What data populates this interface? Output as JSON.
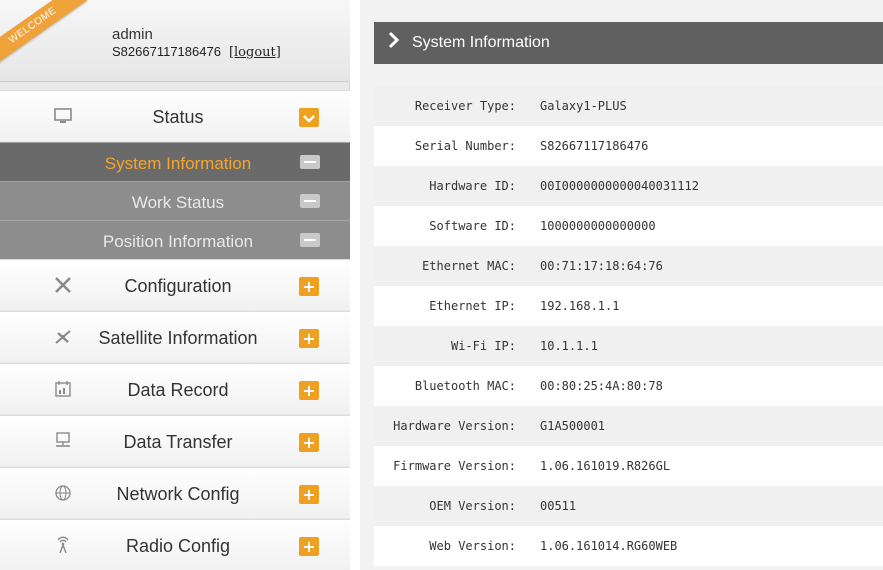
{
  "user": {
    "welcome": "WELCOME",
    "name": "admin",
    "serial": "S82667117186476",
    "logout_label": "[logout]"
  },
  "menu": {
    "status": {
      "label": "Status",
      "icon": "monitor-icon",
      "expander": "collapse"
    },
    "sub_items": [
      {
        "label": "System Information",
        "active": true
      },
      {
        "label": "Work Status",
        "active": false
      },
      {
        "label": "Position Information",
        "active": false
      }
    ],
    "items": [
      {
        "label": "Configuration",
        "icon": "tools-icon",
        "expander": "expand"
      },
      {
        "label": "Satellite Information",
        "icon": "satellite-icon",
        "expander": "expand"
      },
      {
        "label": "Data Record",
        "icon": "calendar-icon",
        "expander": "expand"
      },
      {
        "label": "Data Transfer",
        "icon": "network-icon",
        "expander": "expand"
      },
      {
        "label": "Network Config",
        "icon": "globe-icon",
        "expander": "expand"
      },
      {
        "label": "Radio Config",
        "icon": "antenna-icon",
        "expander": "expand"
      }
    ]
  },
  "panel": {
    "title": "System Information",
    "rows": [
      {
        "key": "Receiver Type:",
        "value": "Galaxy1-PLUS"
      },
      {
        "key": "Serial Number:",
        "value": "S82667117186476"
      },
      {
        "key": "Hardware ID:",
        "value": "00I0000000000040031112"
      },
      {
        "key": "Software ID:",
        "value": "1000000000000000"
      },
      {
        "key": "Ethernet MAC:",
        "value": "00:71:17:18:64:76"
      },
      {
        "key": "Ethernet IP:",
        "value": "192.168.1.1"
      },
      {
        "key": "Wi-Fi IP:",
        "value": "10.1.1.1"
      },
      {
        "key": "Bluetooth MAC:",
        "value": "00:80:25:4A:80:78"
      },
      {
        "key": "Hardware Version:",
        "value": "G1A500001"
      },
      {
        "key": "Firmware Version:",
        "value": "1.06.161019.R826GL"
      },
      {
        "key": "OEM Version:",
        "value": "00511"
      },
      {
        "key": "Web Version:",
        "value": "1.06.161014.RG60WEB"
      }
    ]
  },
  "colors": {
    "accent": "#f0a020",
    "header_bar": "#606060",
    "submenu_bg": "#8d8d8d",
    "submenu_active_bg": "#6a6a6a",
    "active_text": "#f6a52a"
  }
}
